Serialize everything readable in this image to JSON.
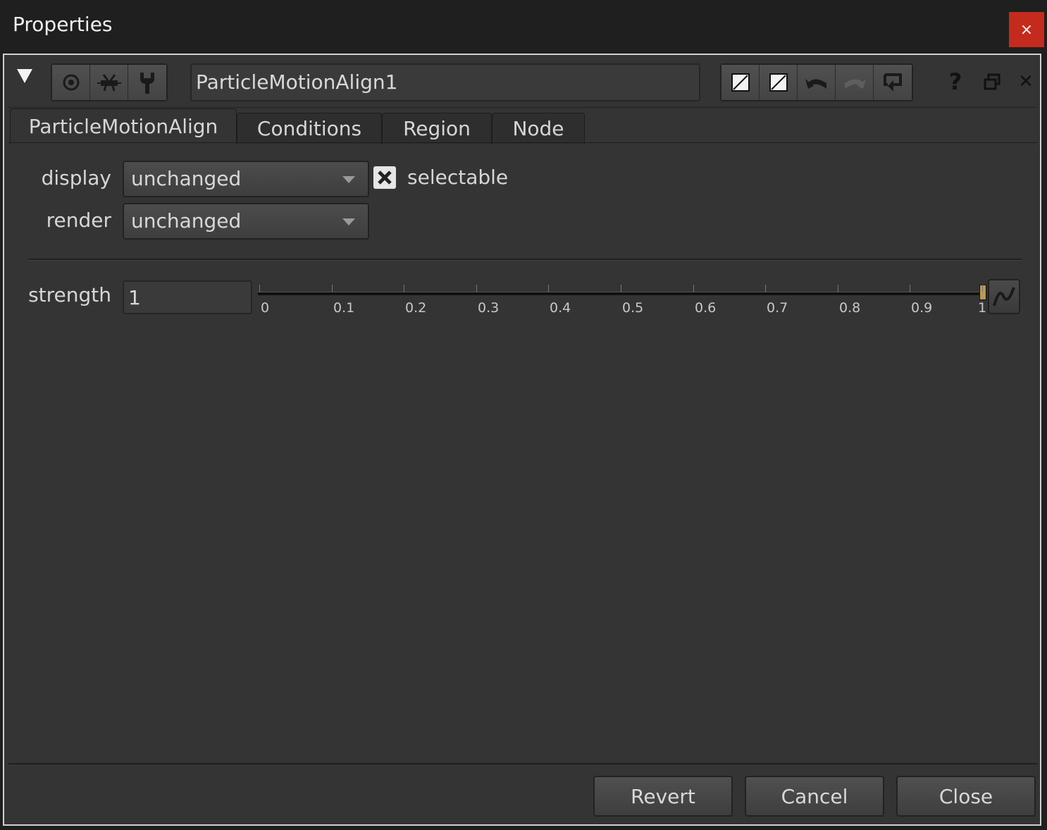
{
  "window": {
    "title": "Properties",
    "close_glyph": "×"
  },
  "toolbar": {
    "node_name": "ParticleMotionAlign1",
    "icons": [
      "collapse-triangle-icon",
      "viewer-circle-icon",
      "node-flip-icon",
      "wrench-icon",
      "color-swatch-icon",
      "color-swatch-icon",
      "undo-icon",
      "redo-icon",
      "revert-icon",
      "help-icon",
      "float-panel-icon",
      "close-panel-icon"
    ],
    "help_glyph": "?",
    "close_glyph": "✕"
  },
  "tabs": [
    {
      "label": "ParticleMotionAlign",
      "active": true
    },
    {
      "label": "Conditions",
      "active": false
    },
    {
      "label": "Region",
      "active": false
    },
    {
      "label": "Node",
      "active": false
    }
  ],
  "knobs": {
    "display_label": "display",
    "display_value": "unchanged",
    "render_label": "render",
    "render_value": "unchanged",
    "selectable_label": "selectable",
    "selectable_checked": true,
    "strength_label": "strength",
    "strength_value": "1",
    "strength_ticks": [
      "0",
      "0.1",
      "0.2",
      "0.3",
      "0.4",
      "0.5",
      "0.6",
      "0.7",
      "0.8",
      "0.9",
      "1"
    ],
    "slider_level": 1
  },
  "footer": {
    "revert_label": "Revert",
    "cancel_label": "Cancel",
    "close_label": "Close"
  },
  "colors": {
    "panel_bg": "#343434",
    "close_red": "#c42b1c",
    "slider_handle": "#b89955"
  }
}
